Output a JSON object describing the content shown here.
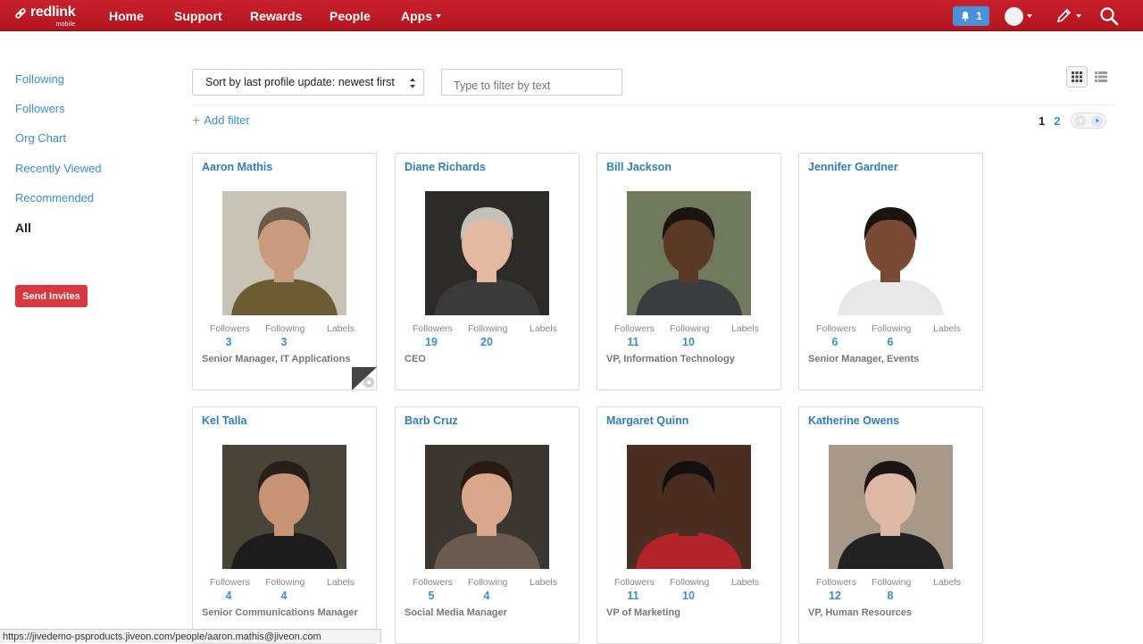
{
  "brand": {
    "name": "redlink",
    "sub": "mobile"
  },
  "nav": {
    "home": "Home",
    "support": "Support",
    "rewards": "Rewards",
    "people": "People",
    "apps": "Apps",
    "notifications_count": "1"
  },
  "sidebar": {
    "items": [
      {
        "label": "Following"
      },
      {
        "label": "Followers"
      },
      {
        "label": "Org Chart"
      },
      {
        "label": "Recently Viewed"
      },
      {
        "label": "Recommended"
      },
      {
        "label": "All"
      }
    ],
    "invite_label": "Send Invites"
  },
  "toolbar": {
    "sort_value": "Sort by last profile update: newest first",
    "filter_placeholder": "Type to filter by text",
    "add_filter_label": "Add filter",
    "pages": [
      "1",
      "2"
    ]
  },
  "stat_labels": {
    "followers": "Followers",
    "following": "Following",
    "labels": "Labels"
  },
  "people": [
    {
      "name": "Aaron Mathis",
      "followers": "3",
      "following": "3",
      "title": "Senior Manager, IT Applications",
      "bg": "#c9c3b5",
      "skin": "#c99a7d",
      "hair": "#6b5a4a",
      "shirt": "#6b5c34"
    },
    {
      "name": "Diane Richards",
      "followers": "19",
      "following": "20",
      "title": "CEO",
      "bg": "#2b2a26",
      "skin": "#e4b9a2",
      "hair": "#c4c1bb",
      "shirt": "#3a3a3a"
    },
    {
      "name": "Bill Jackson",
      "followers": "11",
      "following": "10",
      "title": "VP, Information Technology",
      "bg": "#6f7a5c",
      "skin": "#5a3a26",
      "hair": "#1d1410",
      "shirt": "#3a3c40"
    },
    {
      "name": "Jennifer Gardner",
      "followers": "6",
      "following": "6",
      "title": "Senior Manager, Events",
      "bg": "#ffffff",
      "skin": "#7a4a34",
      "hair": "#1e140f",
      "shirt": "#e8e8e8"
    },
    {
      "name": "Kel Talla",
      "followers": "4",
      "following": "4",
      "title": "Senior Communications Manager",
      "bg": "#4a4438",
      "skin": "#c89274",
      "hair": "#2a1f18",
      "shirt": "#1c1c1c"
    },
    {
      "name": "Barb Cruz",
      "followers": "5",
      "following": "4",
      "title": "Social Media Manager",
      "bg": "#3b3630",
      "skin": "#d9a88c",
      "hair": "#2b1a12",
      "shirt": "#6b5a50"
    },
    {
      "name": "Margaret Quinn",
      "followers": "11",
      "following": "10",
      "title": "VP of Marketing",
      "bg": "#4a2e22",
      "skin": "#4a2c20",
      "hair": "#141010",
      "shirt": "#b2232a"
    },
    {
      "name": "Katherine Owens",
      "followers": "12",
      "following": "8",
      "title": "VP, Human Resources",
      "bg": "#a89888",
      "skin": "#ddb8a4",
      "hair": "#1c1410",
      "shirt": "#222222"
    }
  ],
  "status_url": "https://jivedemo-psproducts.jiveon.com/people/aaron.mathis@jiveon.com"
}
